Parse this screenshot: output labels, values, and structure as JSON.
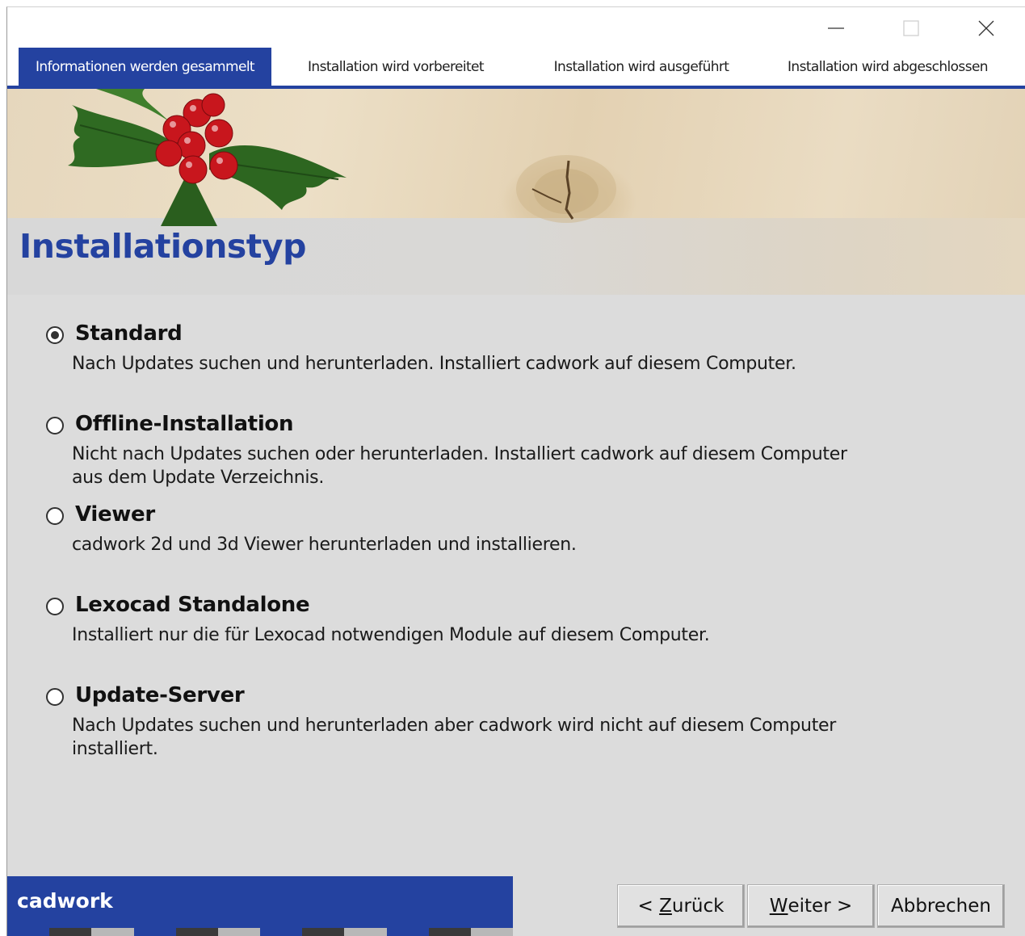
{
  "tabs": [
    {
      "label": "Informationen werden gesammelt",
      "active": true
    },
    {
      "label": "Installation wird vorbereitet",
      "active": false
    },
    {
      "label": "Installation wird ausgeführt",
      "active": false
    },
    {
      "label": "Installation wird abgeschlossen",
      "active": false
    }
  ],
  "page_title": "Installationstyp",
  "options": [
    {
      "label": "Standard",
      "selected": true,
      "description": "Nach Updates suchen und herunterladen. Installiert cadwork auf diesem Computer."
    },
    {
      "label": "Offline-Installation",
      "selected": false,
      "description": "Nicht nach Updates suchen oder herunterladen. Installiert cadwork auf diesem Computer aus dem Update Verzeichnis."
    },
    {
      "label": "Viewer",
      "selected": false,
      "description": "cadwork 2d und 3d Viewer herunterladen und installieren."
    },
    {
      "label": "Lexocad Standalone",
      "selected": false,
      "description": "Installiert nur die für Lexocad notwendigen Module auf diesem Computer."
    },
    {
      "label": "Update-Server",
      "selected": false,
      "description": "Nach Updates suchen und herunterladen aber cadwork wird nicht auf diesem Computer installiert."
    }
  ],
  "brand": {
    "name": "cadwork"
  },
  "buttons": {
    "back": {
      "prefix": "< ",
      "mnemonic": "Z",
      "rest": "urück"
    },
    "next": {
      "mnemonic": "W",
      "rest": "eiter >"
    },
    "cancel": {
      "label": "Abbrechen"
    }
  },
  "colors": {
    "accent": "#2442a0",
    "stripe_dark": "#3a3a3a",
    "stripe_light": "#b8b8b8"
  }
}
